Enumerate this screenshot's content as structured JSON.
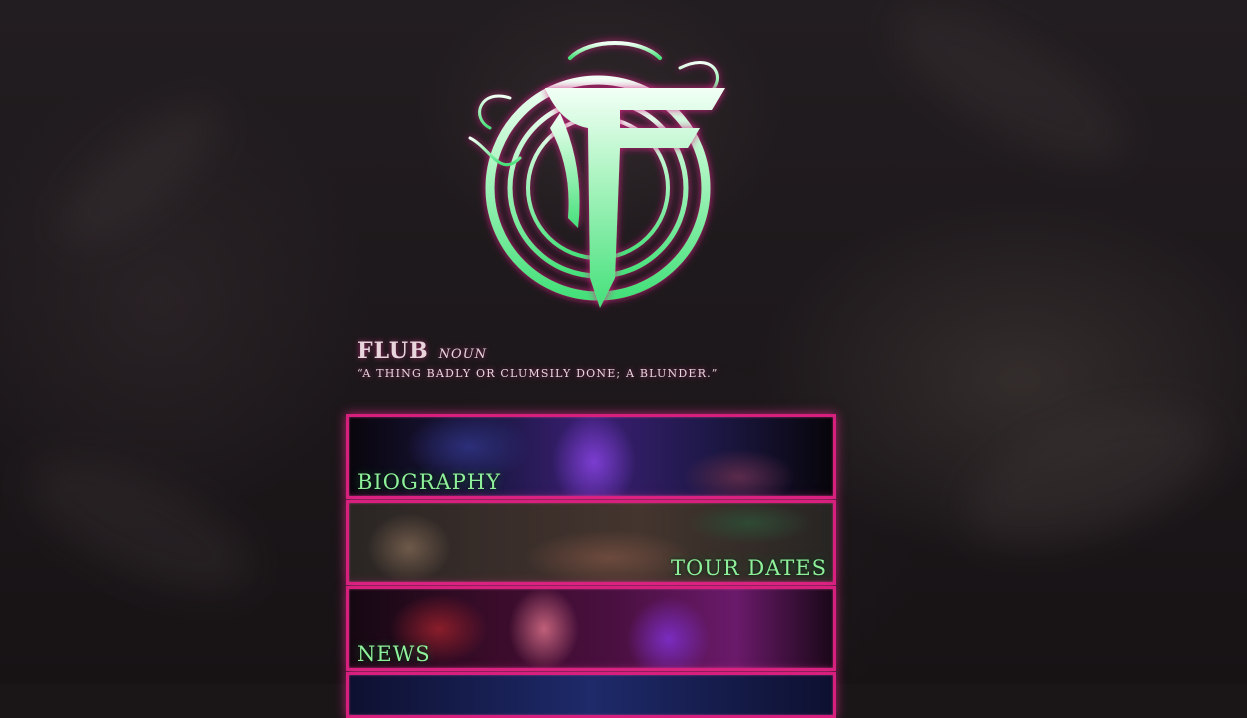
{
  "logo": {
    "name": "band-logo-f-emblem",
    "colors": {
      "fill": "#7cf09c",
      "glow": "#d7207e"
    }
  },
  "tagline": {
    "word": "FLUB",
    "part_of_speech": "NOUN",
    "definition": "“A thing badly or clumsily done; a blunder.”"
  },
  "nav": {
    "biography": "BIOGRAPHY",
    "tour_dates": "TOUR DATES",
    "news": "NEWS"
  },
  "theme": {
    "accent": "#d7207e",
    "label_color": "#8ef09a",
    "background": "#1d181b"
  }
}
